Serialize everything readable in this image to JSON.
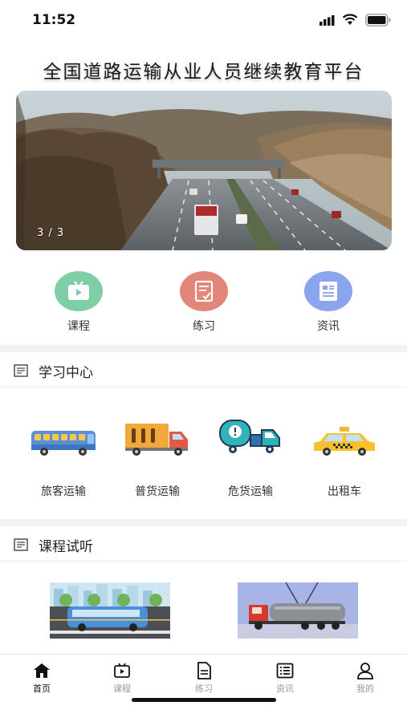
{
  "status": {
    "time": "11:52"
  },
  "app": {
    "title": "全国道路运输从业人员继续教育平台"
  },
  "banner": {
    "counter": "3 / 3"
  },
  "quick_nav": [
    {
      "label": "课程",
      "icon": "tv-icon",
      "color": "#7fcfa6"
    },
    {
      "label": "练习",
      "icon": "exercise-icon",
      "color": "#e2857a"
    },
    {
      "label": "资讯",
      "icon": "news-icon",
      "color": "#8aa4ee"
    }
  ],
  "study_center": {
    "title": "学习中心",
    "items": [
      {
        "label": "旅客运输",
        "icon": "bus-icon"
      },
      {
        "label": "普货运输",
        "icon": "cargo-truck-icon"
      },
      {
        "label": "危货运输",
        "icon": "hazard-truck-icon"
      },
      {
        "label": "出租车",
        "icon": "taxi-icon"
      }
    ]
  },
  "trial": {
    "title": "课程试听"
  },
  "tabbar": [
    {
      "label": "首页",
      "icon": "home-icon",
      "active": true
    },
    {
      "label": "课程",
      "icon": "video-icon",
      "active": false
    },
    {
      "label": "练习",
      "icon": "document-icon",
      "active": false
    },
    {
      "label": "资讯",
      "icon": "list-icon",
      "active": false
    },
    {
      "label": "我的",
      "icon": "user-icon",
      "active": false
    }
  ],
  "colors": {
    "accent_green": "#7fcfa6",
    "accent_red": "#e2857a",
    "accent_blue": "#8aa4ee"
  }
}
